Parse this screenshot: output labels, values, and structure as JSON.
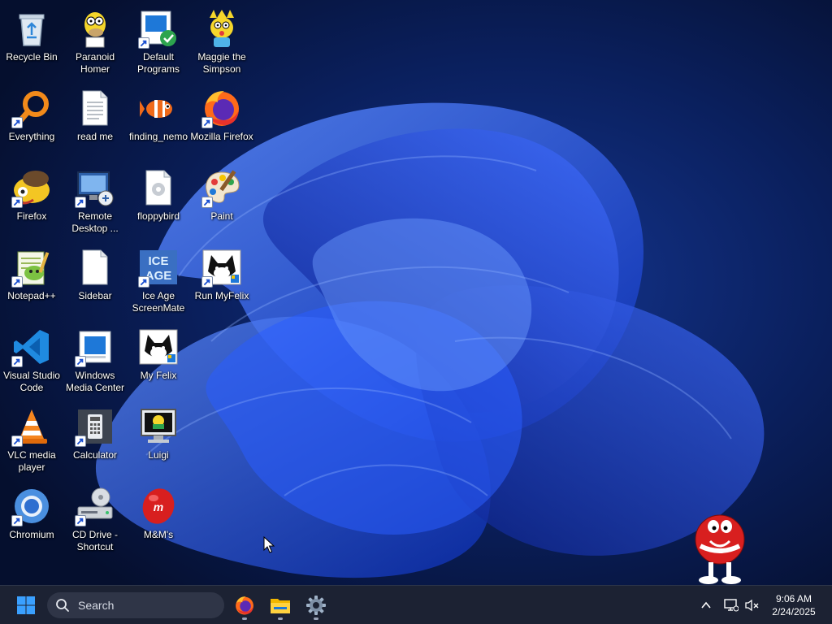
{
  "desktop": {
    "icons": [
      {
        "label": "Recycle Bin"
      },
      {
        "label": "Paranoid Homer"
      },
      {
        "label": "Default Programs"
      },
      {
        "label": "Maggie the Simpson"
      },
      {
        "label": "Everything"
      },
      {
        "label": "read me"
      },
      {
        "label": "finding_nemo"
      },
      {
        "label": "Mozilla Firefox"
      },
      {
        "label": "Firefox"
      },
      {
        "label": "Remote Desktop ..."
      },
      {
        "label": "floppybird"
      },
      {
        "label": "Paint"
      },
      {
        "label": "Notepad++"
      },
      {
        "label": "Sidebar"
      },
      {
        "label": "Ice Age ScreenMate"
      },
      {
        "label": "Run MyFelix"
      },
      {
        "label": "Visual Studio Code"
      },
      {
        "label": "Windows Media Center"
      },
      {
        "label": "My Felix"
      },
      {
        "label": "VLC media player"
      },
      {
        "label": "Calculator"
      },
      {
        "label": "Luigi"
      },
      {
        "label": "Chromium"
      },
      {
        "label": "CD Drive - Shortcut"
      },
      {
        "label": "M&M's"
      }
    ]
  },
  "taskbar": {
    "search_placeholder": "Search",
    "pinned_apps": [
      "firefox-icon",
      "file-explorer-icon",
      "settings-icon"
    ],
    "tray_icons": [
      "chevron-up-icon",
      "network-icon",
      "volume-muted-icon"
    ],
    "clock_time": "9:06 AM",
    "clock_date": "2/24/2025"
  },
  "colors": {
    "wallpaper_bg": "#06163f",
    "wallpaper_bloom": "#1e4be0",
    "taskbar_bg": "#1c2233",
    "start_blue": "#3aa0ff"
  }
}
